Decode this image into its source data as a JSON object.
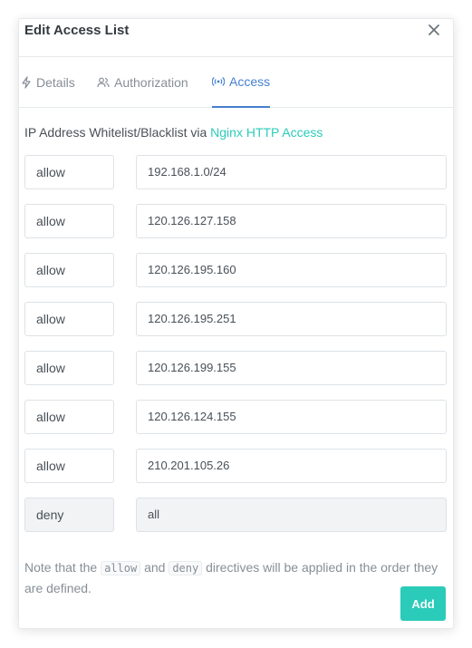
{
  "modal": {
    "title": "Edit Access List",
    "close_icon": "close-icon"
  },
  "tabs": [
    {
      "label": "Details",
      "icon": "bolt-icon"
    },
    {
      "label": "Authorization",
      "icon": "users-icon"
    },
    {
      "label": "Access",
      "icon": "broadcast-icon",
      "active": true
    }
  ],
  "intro": {
    "text": "IP Address Whitelist/Blacklist via ",
    "link": "Nginx HTTP Access"
  },
  "rules": [
    {
      "directive": "allow",
      "address": "192.168.1.0/24"
    },
    {
      "directive": "allow",
      "address": "120.126.127.158"
    },
    {
      "directive": "allow",
      "address": "120.126.195.160"
    },
    {
      "directive": "allow",
      "address": "120.126.195.251"
    },
    {
      "directive": "allow",
      "address": "120.126.199.155"
    },
    {
      "directive": "allow",
      "address": "120.126.124.155"
    },
    {
      "directive": "allow",
      "address": "210.201.105.26"
    },
    {
      "directive": "deny",
      "address": "all"
    }
  ],
  "note": {
    "prefix": "Note that the ",
    "code1": "allow",
    "mid": " and ",
    "code2": "deny",
    "suffix": " directives will be applied in the order they are defined."
  },
  "add_button": "Add",
  "colors": {
    "accent": "#467fcf",
    "teal": "#2bcbba"
  }
}
